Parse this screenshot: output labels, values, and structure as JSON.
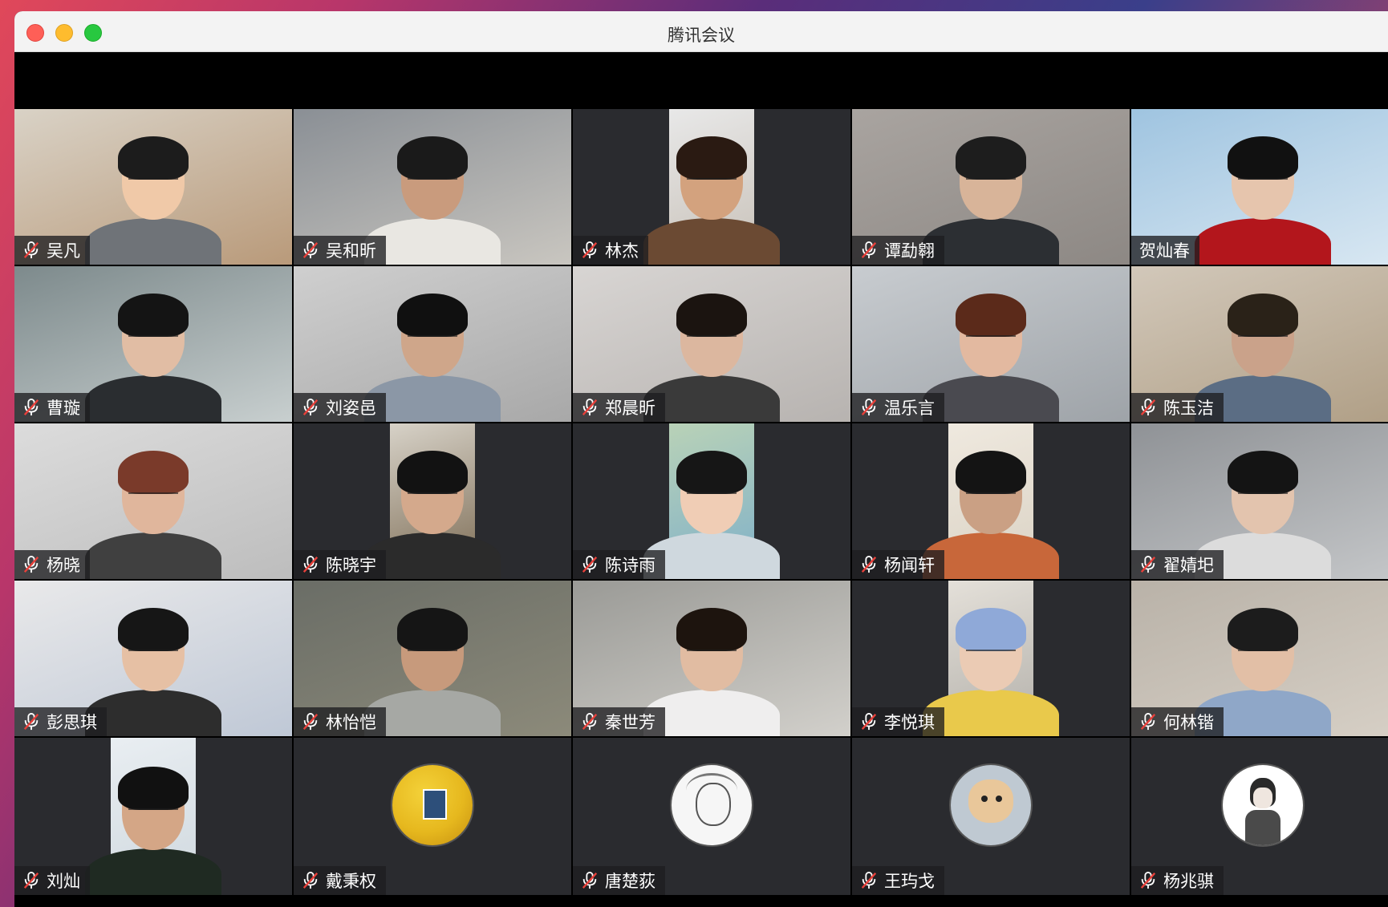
{
  "window": {
    "title": "腾讯会议"
  },
  "participants": [
    {
      "name": "吴凡",
      "muted": true,
      "type": "video"
    },
    {
      "name": "吴和昕",
      "muted": true,
      "type": "video"
    },
    {
      "name": "林杰",
      "muted": true,
      "type": "video-narrow"
    },
    {
      "name": "谭勐翱",
      "muted": true,
      "type": "video"
    },
    {
      "name": "贺灿春",
      "muted": false,
      "type": "video"
    },
    {
      "name": "曹璇",
      "muted": true,
      "type": "video"
    },
    {
      "name": "刘姿邑",
      "muted": true,
      "type": "video"
    },
    {
      "name": "郑晨昕",
      "muted": true,
      "type": "video"
    },
    {
      "name": "温乐言",
      "muted": true,
      "type": "video"
    },
    {
      "name": "陈玉洁",
      "muted": true,
      "type": "video"
    },
    {
      "name": "杨晓",
      "muted": true,
      "type": "video"
    },
    {
      "name": "陈晓宇",
      "muted": true,
      "type": "video-narrow"
    },
    {
      "name": "陈诗雨",
      "muted": true,
      "type": "video-narrow"
    },
    {
      "name": "杨闻轩",
      "muted": true,
      "type": "video-narrow"
    },
    {
      "name": "翟婧圯",
      "muted": true,
      "type": "video"
    },
    {
      "name": "彭思琪",
      "muted": true,
      "type": "video"
    },
    {
      "name": "林怡恺",
      "muted": true,
      "type": "video"
    },
    {
      "name": "秦世芳",
      "muted": true,
      "type": "video"
    },
    {
      "name": "李悦琪",
      "muted": true,
      "type": "video-narrow"
    },
    {
      "name": "何林锴",
      "muted": true,
      "type": "video"
    },
    {
      "name": "刘灿",
      "muted": true,
      "type": "video-narrow"
    },
    {
      "name": "戴秉权",
      "muted": true,
      "type": "avatar"
    },
    {
      "name": "唐楚荻",
      "muted": true,
      "type": "avatar"
    },
    {
      "name": "王玙戈",
      "muted": true,
      "type": "avatar"
    },
    {
      "name": "杨兆骐",
      "muted": true,
      "type": "avatar"
    }
  ],
  "colors": {
    "tile_background": "#2a2b2f",
    "namebar": "#1e1e20",
    "mic_muted": "#ffffff"
  }
}
